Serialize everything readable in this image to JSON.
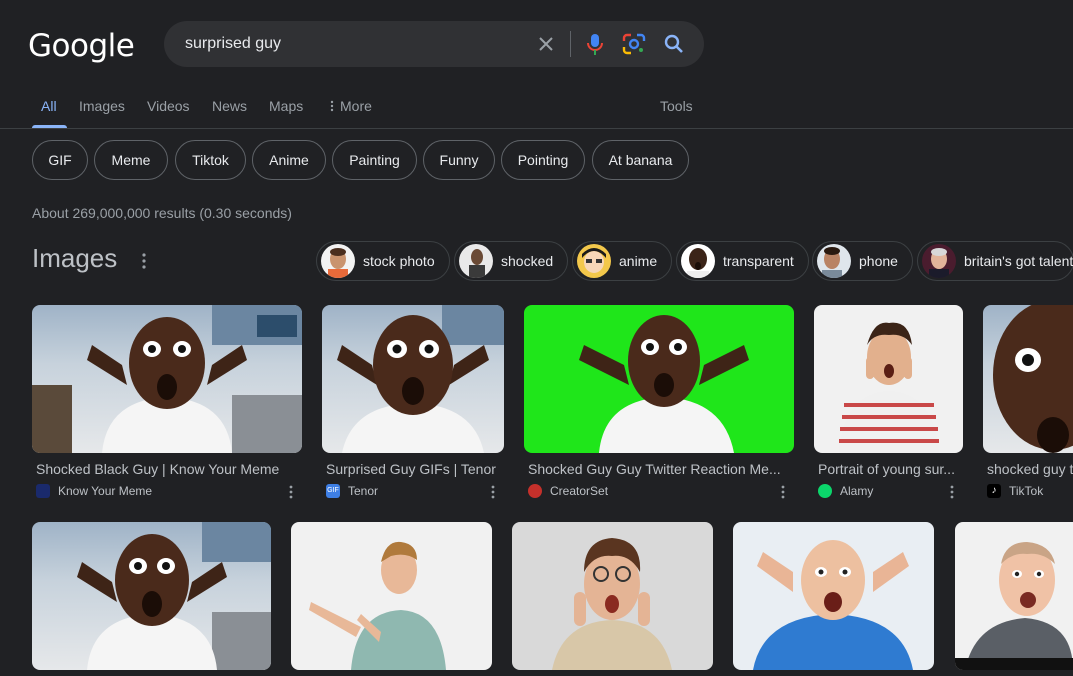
{
  "logo": "Google",
  "search": {
    "query": "surprised guy"
  },
  "tabs": [
    {
      "label": "All",
      "active": true
    },
    {
      "label": "Images"
    },
    {
      "label": "Videos"
    },
    {
      "label": "News"
    },
    {
      "label": "Maps"
    },
    {
      "label": "More"
    },
    {
      "label": "Tools"
    }
  ],
  "chips": [
    "GIF",
    "Meme",
    "Tiktok",
    "Anime",
    "Painting",
    "Funny",
    "Pointing",
    "At banana"
  ],
  "stats": "About 269,000,000 results (0.30 seconds)",
  "images": {
    "title": "Images",
    "related": [
      "stock photo",
      "shocked",
      "anime",
      "transparent",
      "phone",
      "britain's got talent"
    ],
    "row1": [
      {
        "title": "Shocked Black Guy | Know Your Meme",
        "source": "Know Your Meme"
      },
      {
        "title": "Surprised Guy GIFs | Tenor",
        "source": "Tenor"
      },
      {
        "title": "Shocked Guy Guy Twitter Reaction Me...",
        "source": "CreatorSet"
      },
      {
        "title": "Portrait of young sur...",
        "source": "Alamy"
      },
      {
        "title": "shocked guy t",
        "source": "TikTok"
      }
    ]
  },
  "icons": {
    "clear": "close-icon",
    "mic": "microphone-icon",
    "lens": "google-lens-icon",
    "search": "search-icon",
    "more": "more-vertical-icon"
  },
  "colors": {
    "background": "#202124",
    "accent": "#8ab4f8",
    "searchbox": "#303134"
  }
}
